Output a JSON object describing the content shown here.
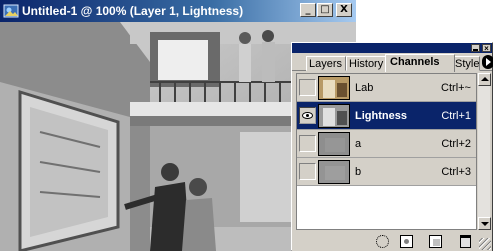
{
  "document": {
    "title": "Untitled-1 @ 100% (Layer 1, Lightness)",
    "icon": "photoshop-doc-icon",
    "buttons": {
      "minimize": "_",
      "maximize": "□",
      "close": "X"
    }
  },
  "palette": {
    "tabs": [
      {
        "label": "Layers",
        "active": false
      },
      {
        "label": "History",
        "active": false
      },
      {
        "label": "Channels",
        "active": true
      },
      {
        "label": "Styles",
        "active": false
      }
    ],
    "channels": [
      {
        "name": "Lab",
        "shortcut": "Ctrl+~",
        "visible": false,
        "selected": false,
        "thumb": "color"
      },
      {
        "name": "Lightness",
        "shortcut": "Ctrl+1",
        "visible": true,
        "selected": true,
        "thumb": "gray"
      },
      {
        "name": "a",
        "shortcut": "Ctrl+2",
        "visible": false,
        "selected": false,
        "thumb": "flat"
      },
      {
        "name": "b",
        "shortcut": "Ctrl+3",
        "visible": false,
        "selected": false,
        "thumb": "flat"
      }
    ],
    "bottom_icons": [
      "load-selection-icon",
      "save-selection-icon",
      "new-channel-icon",
      "trash-icon"
    ]
  },
  "colors": {
    "titlebar": "#0a246a",
    "selection": "#0a246a",
    "chrome": "#d4d0c8"
  }
}
